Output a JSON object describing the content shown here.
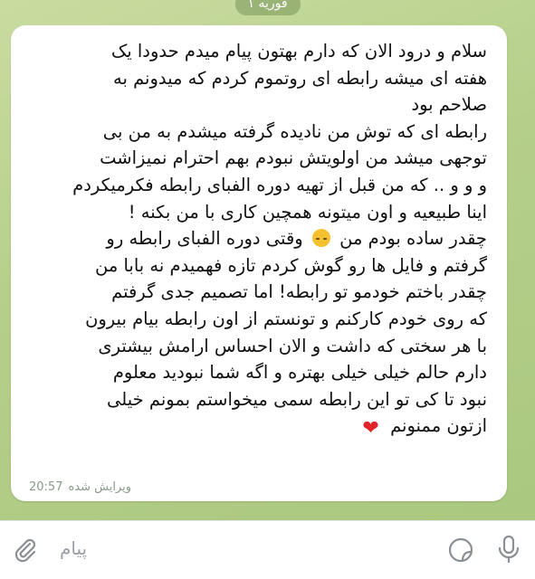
{
  "date_chip": "فوریه ۱",
  "message": {
    "lines": [
      "سلام و درود الان که دارم بهتون پیام میدم حدودا  یک",
      "هفته ای میشه رابطه ای روتموم کردم که میدونم به",
      "صلاحم بود",
      "رابطه ای که توش من نادیده گرفته میشدم به من بی",
      "توجهی میشد من اولویتش نبودم بهم احترام نمیزاشت",
      "و و و .. که من قبل از تهیه دوره الفبای رابطه فکرمیکردم",
      "اینا طبیعیه و اون میتونه همچین کاری با من بکنه !"
    ],
    "line8_start": "چقدر ساده بودم من",
    "line8_end": "وقتی دوره الفبای رابطه رو",
    "lines_b": [
      "گرفتم و فایل ها رو گوش کردم تازه فهمیدم نه بابا من",
      "چقدر باختم خودمو تو رابطه!  اما تصمیم جدی گرفتم",
      "که روی خودم کارکنم و  تونستم از اون رابطه بیام بیرون",
      "با هر سختی  که داشت و الان احساس ارامش بیشتری",
      "دارم حالم خیلی خیلی بهتره و اگه شما نبودید معلوم",
      "نبود تا کی تو این رابطه سمی میخواستم بمونم خیلی"
    ],
    "last_line": "ازتون ممنونم",
    "edited_label": "ویرایش شده",
    "time": "20:57"
  },
  "input": {
    "placeholder": "پیام"
  },
  "icons": {
    "attach": "paperclip-icon",
    "sticker": "sticker-icon",
    "mic": "microphone-icon",
    "emoji_face": "upside-down-face-emoji",
    "heart": "red-heart-emoji"
  }
}
